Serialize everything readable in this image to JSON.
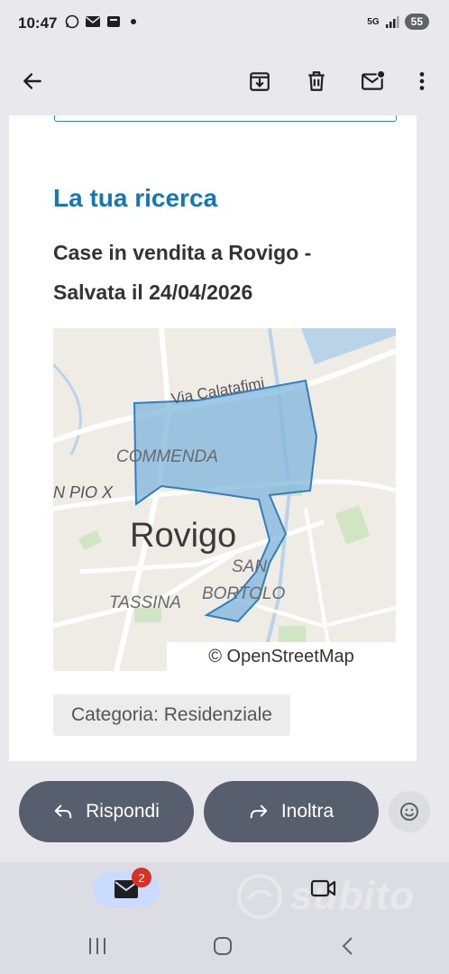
{
  "status_bar": {
    "time": "10:47",
    "network": "5G",
    "battery": "55"
  },
  "email": {
    "heading": "La tua ricerca",
    "subtitle": "Case in vendita a Rovigo - Salvata il 24/04/2026",
    "map": {
      "city": "Rovigo",
      "labels": [
        "Via Calatafimi",
        "COMMENDA",
        "N PIO X",
        "SAN",
        "BORTOLO",
        "TASSINA"
      ],
      "attribution": "© OpenStreetMap"
    },
    "category": "Categoria: Residenziale"
  },
  "actions": {
    "reply": "Rispondi",
    "forward": "Inoltra"
  },
  "bottom_nav": {
    "mail_badge": "2",
    "watermark": "subito"
  },
  "colors": {
    "accent": "#1577b6",
    "button": "#575f6e",
    "map_polygon": "#7fb6dc"
  }
}
